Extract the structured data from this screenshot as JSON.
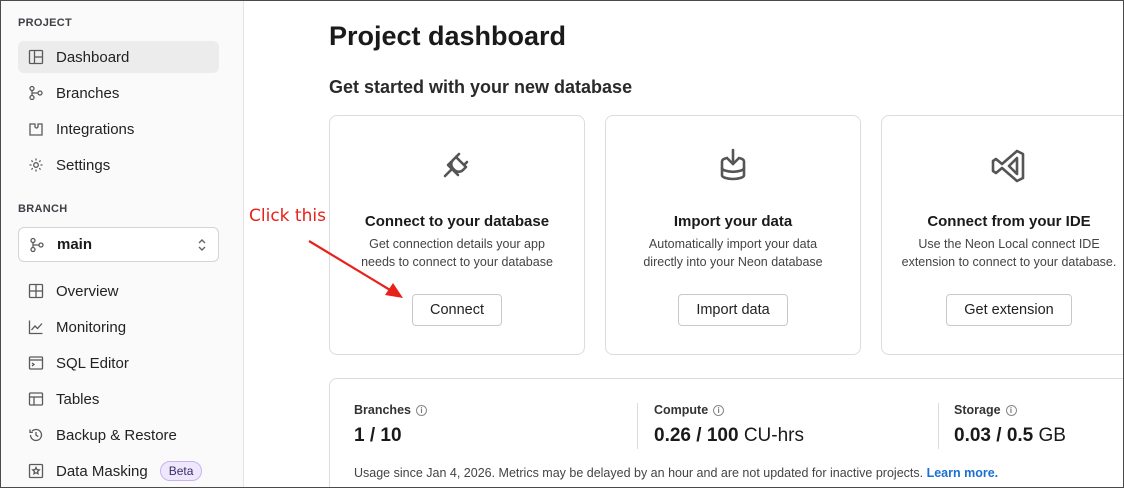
{
  "sidebar": {
    "project_label": "PROJECT",
    "project_items": [
      {
        "label": "Dashboard",
        "icon": "dashboard-icon",
        "active": true
      },
      {
        "label": "Branches",
        "icon": "branches-icon"
      },
      {
        "label": "Integrations",
        "icon": "integrations-icon"
      },
      {
        "label": "Settings",
        "icon": "gear-icon"
      }
    ],
    "branch_label": "BRANCH",
    "branch_select": {
      "value": "main",
      "icon": "branch-icon",
      "chevron": "chevron-updown-icon"
    },
    "branch_items": [
      {
        "label": "Overview",
        "icon": "overview-icon"
      },
      {
        "label": "Monitoring",
        "icon": "monitoring-icon"
      },
      {
        "label": "SQL Editor",
        "icon": "sql-editor-icon"
      },
      {
        "label": "Tables",
        "icon": "tables-icon"
      },
      {
        "label": "Backup & Restore",
        "icon": "history-icon"
      },
      {
        "label": "Data Masking",
        "icon": "masking-icon",
        "badge": "Beta"
      }
    ]
  },
  "main": {
    "title": "Project dashboard",
    "subtitle": "Get started with your new database",
    "cards": [
      {
        "icon": "plug-icon",
        "title": "Connect to your database",
        "desc_line1": "Get connection details your app",
        "desc_line2": "needs to connect to your database",
        "button": "Connect"
      },
      {
        "icon": "import-database-icon",
        "title": "Import your data",
        "desc_line1": "Automatically import your data",
        "desc_line2": "directly into your Neon database",
        "button": "Import data"
      },
      {
        "icon": "vscode-icon",
        "title": "Connect from your IDE",
        "desc_line1": "Use the Neon Local connect IDE",
        "desc_line2": "extension to connect to your database.",
        "button": "Get extension"
      }
    ],
    "usage": {
      "branches": {
        "label": "Branches",
        "value": "1 / 10"
      },
      "compute": {
        "label": "Compute",
        "value": "0.26 / 100",
        "unit": "CU-hrs"
      },
      "storage": {
        "label": "Storage",
        "value": "0.03 / 0.5",
        "unit": "GB"
      },
      "note": "Usage since Jan 4, 2026. Metrics may be delayed by an hour and are not updated for inactive projects.",
      "learn_more": "Learn more."
    }
  },
  "annotation": {
    "text": "Click this",
    "color": "#e8211b"
  }
}
